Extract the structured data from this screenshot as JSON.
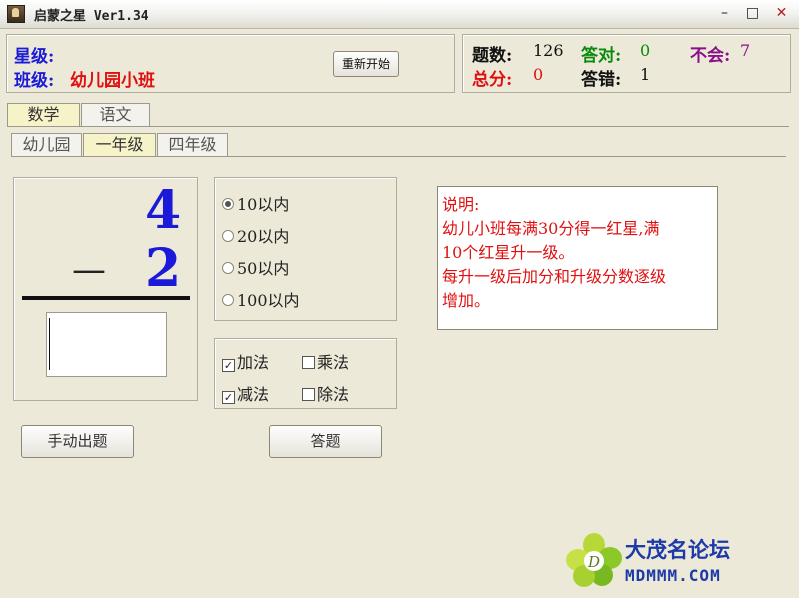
{
  "window": {
    "title": "启蒙之星 Ver1.34",
    "minimize": "–",
    "maximize": "□",
    "close": "✕"
  },
  "header": {
    "star_level_label": "星级:",
    "class_label": "班级:",
    "class_value": "幼儿园小班",
    "restart_button": "重新开始"
  },
  "stats": {
    "total_label": "题数:",
    "total_value": "126",
    "correct_label": "答对:",
    "correct_value": "0",
    "unknown_label": "不会:",
    "unknown_value": "7",
    "score_label": "总分:",
    "score_value": "0",
    "wrong_label": "答错:",
    "wrong_value": "1"
  },
  "subject_tabs": [
    "数学",
    "语文"
  ],
  "grade_tabs": [
    "幼儿园",
    "一年级",
    "四年级"
  ],
  "problem": {
    "top_number": "4",
    "operator": "—",
    "bottom_number": "2",
    "answer": ""
  },
  "ranges": [
    {
      "label": "10以内",
      "selected": true
    },
    {
      "label": "20以内",
      "selected": false
    },
    {
      "label": "50以内",
      "selected": false
    },
    {
      "label": "100以内",
      "selected": false
    }
  ],
  "operations": [
    {
      "label": "加法",
      "checked": true
    },
    {
      "label": "乘法",
      "checked": false
    },
    {
      "label": "减法",
      "checked": true
    },
    {
      "label": "除法",
      "checked": false
    }
  ],
  "info": {
    "heading": "说明:",
    "line1": "幼儿小班每满30分得一红星,满",
    "line2": "10个红星升一级。",
    "line3": "每升一级后加分和升级分数逐级",
    "line4": "增加。"
  },
  "buttons": {
    "manual": "手动出题",
    "answer": "答题"
  },
  "watermark": {
    "name": "大茂名论坛",
    "url": "MDMMM.COM"
  },
  "colors": {
    "class_value": "#e01010",
    "label_blue": "#1a1ad8",
    "correct": "#0a8a0a",
    "unknown": "#8a108a",
    "score": "#e01010",
    "number": "#1a1ad8",
    "info_text": "#e01010",
    "logo": "#1e3aa8"
  }
}
